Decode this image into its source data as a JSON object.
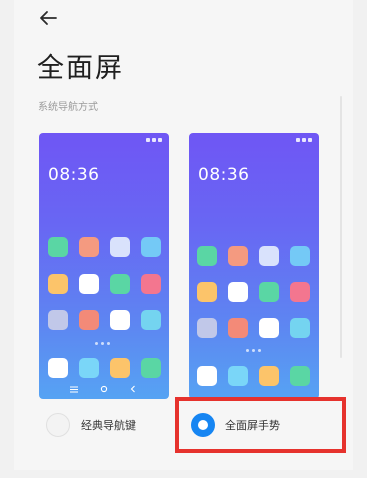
{
  "header": {
    "back_icon": "arrow-left-icon",
    "title": "全面屏"
  },
  "section": {
    "label": "系统导航方式"
  },
  "previews": {
    "classic": {
      "time": "08:36",
      "nav_keys": [
        "menu-icon",
        "home-icon",
        "back-icon"
      ]
    },
    "gesture": {
      "time": "08:36"
    }
  },
  "app_colors": {
    "classic": [
      "#5ad6a4",
      "#f49a80",
      "#d9e2fc",
      "#74c9f6",
      "#fcc46a",
      "#ffffff",
      "#5ad6a4",
      "#f3768f",
      "#c1c8e9",
      "#f38a78",
      "#ffffff",
      "#74d4f0",
      "#ffffff",
      "#7ad6f8",
      "#fcc46a",
      "#5ad6a4"
    ],
    "gesture": [
      "#5ad6a4",
      "#f49a80",
      "#d9e2fc",
      "#74c9f6",
      "#fcc46a",
      "#ffffff",
      "#5ad6a4",
      "#f3768f",
      "#c1c8e9",
      "#f38a78",
      "#ffffff",
      "#74d4f0",
      "#ffffff",
      "#7ad6f8",
      "#fcc46a",
      "#5ad6a4"
    ]
  },
  "options": {
    "classic": {
      "label": "经典导航键",
      "selected": false
    },
    "gesture": {
      "label": "全面屏手势",
      "selected": true
    }
  },
  "colors": {
    "accent": "#1685f2",
    "highlight": "#e6322d"
  }
}
